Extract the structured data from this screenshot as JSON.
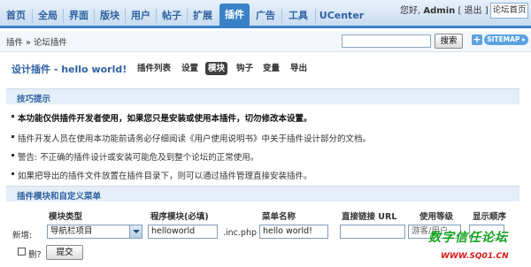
{
  "nav": {
    "tabs": [
      "首页",
      "全局",
      "界面",
      "版块",
      "用户",
      "帖子",
      "扩展",
      "插件",
      "广告",
      "工具",
      "UCenter"
    ],
    "active_index": 7,
    "greeting": "您好,",
    "username": "Admin",
    "logout": "[ 退出 ]",
    "forum_home": "论坛首页"
  },
  "crumb": {
    "text": "插件 » 论坛插件",
    "search_button": "搜索",
    "plus": "+",
    "sitemap": "SITEMAP ▸"
  },
  "page": {
    "title": "设计插件  - hello world!",
    "subtabs": [
      "插件列表",
      "设置",
      "模块",
      "钩子",
      "变量",
      "导出"
    ],
    "active_subtab": 2
  },
  "tips": {
    "heading": "技巧提示",
    "items": [
      "本功能仅供插件开发者使用，如果您只是安装或使用本插件，切勿修改本设置。",
      "插件开发人员在使用本功能前请务必仔细阅读《用户使用说明书》中关于插件设计部分的文档。",
      "警告: 不正确的插件设计或安装可能危及到整个论坛的正常使用。",
      "如果把导出的插件文件放置在插件目录下，则可以通过插件管理直接安装插件。"
    ]
  },
  "modules": {
    "heading": "插件模块和自定义菜单",
    "columns": [
      "模块类型",
      "程序模块(必填)",
      "菜单名称",
      "直接链接 URL",
      "使用等级",
      "显示顺序"
    ],
    "row_label": "新增:",
    "type_value": "导航栏项目",
    "module_value": "helloworld",
    "ext": ".inc.php",
    "menu_name_value": "hello world!",
    "level_partial": "游客/用户",
    "delete_label": "删?",
    "submit": "提交"
  },
  "watermark": {
    "line1": "数字信任论坛",
    "line2": "WWW.SQ01.CN"
  }
}
